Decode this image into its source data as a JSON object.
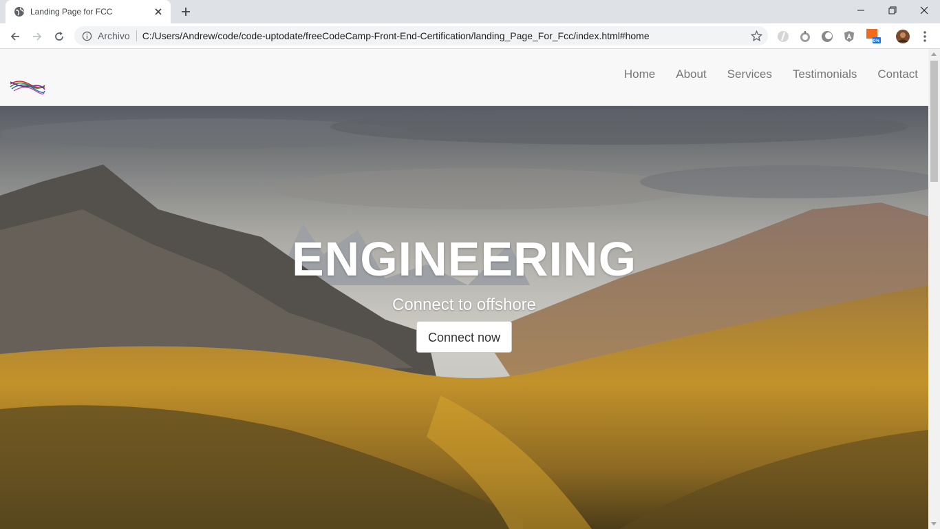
{
  "browser": {
    "tab_title": "Landing Page for FCC",
    "omnibox": {
      "scheme_label": "Archivo",
      "url": "C:/Users/Andrew/code/code-uptodate/freeCodeCamp-Front-End-Certification/landing_Page_For_Fcc/index.html#home"
    },
    "icons": [
      "globe-icon",
      "close-icon",
      "plus-icon",
      "minimize-icon",
      "restore-icon",
      "window-close-icon",
      "back-icon",
      "forward-icon",
      "reload-icon",
      "info-icon",
      "star-icon",
      "menu-icon"
    ]
  },
  "site": {
    "nav": {
      "items": [
        {
          "label": "Home"
        },
        {
          "label": "About"
        },
        {
          "label": "Services"
        },
        {
          "label": "Testimonials"
        },
        {
          "label": "Contact"
        }
      ]
    },
    "hero": {
      "title": "ENGINEERING",
      "subtitle": "Connect to offshore",
      "button_label": "Connect now"
    }
  },
  "colors": {
    "tabstrip_bg": "#dee1e6",
    "nav_bg": "#f8f8f8",
    "nav_text": "#777777",
    "hero_text": "#ffffff"
  }
}
